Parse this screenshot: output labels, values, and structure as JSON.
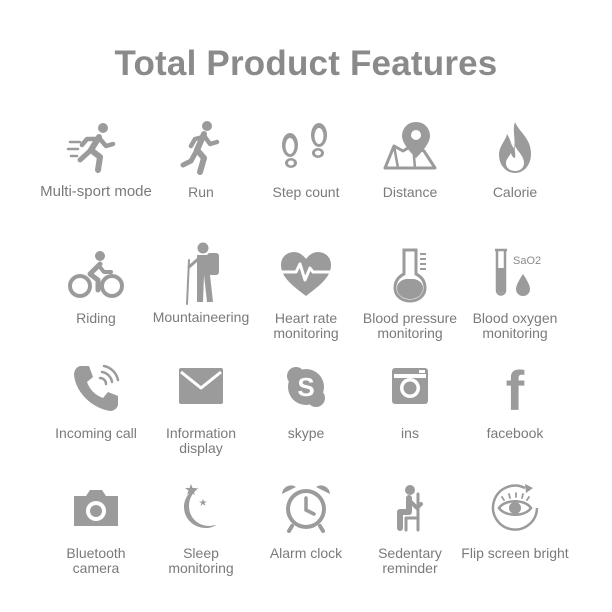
{
  "title": "Total Product Features",
  "features": [
    {
      "label": "Multi-sport mode",
      "icon": "running-person-speed-icon"
    },
    {
      "label": "Run",
      "icon": "runner-icon"
    },
    {
      "label": "Step count",
      "icon": "footprints-icon"
    },
    {
      "label": "Distance",
      "icon": "map-pin-icon"
    },
    {
      "label": "Calorie",
      "icon": "flame-icon"
    },
    {
      "label": "Riding",
      "icon": "cyclist-icon"
    },
    {
      "label": "Mountaineering",
      "icon": "hiker-icon"
    },
    {
      "label": "Heart rate\nmonitoring",
      "icon": "heart-pulse-icon"
    },
    {
      "label": "Blood pressure\nmonitoring",
      "icon": "thermometer-icon"
    },
    {
      "label": "Blood oxygen\nmonitoring",
      "icon": "test-tube-drop-icon",
      "icon_text": "SaO2"
    },
    {
      "label": "Incoming call",
      "icon": "phone-ringing-icon"
    },
    {
      "label": "Information\ndisplay",
      "icon": "envelope-icon"
    },
    {
      "label": "skype",
      "icon": "skype-icon",
      "icon_text": "S"
    },
    {
      "label": "ins",
      "icon": "instagram-icon"
    },
    {
      "label": "facebook",
      "icon": "facebook-icon",
      "icon_text": "f"
    },
    {
      "label": "Bluetooth\ncamera",
      "icon": "camera-icon"
    },
    {
      "label": "Sleep\nmonitoring",
      "icon": "moon-stars-icon"
    },
    {
      "label": "Alarm clock",
      "icon": "alarm-clock-icon"
    },
    {
      "label": "Sedentary\nreminder",
      "icon": "seated-person-icon"
    },
    {
      "label": "Flip screen bright",
      "icon": "eye-rotate-icon"
    }
  ],
  "colors": {
    "icon": "#9b9b9b",
    "text": "#7a7a7a",
    "title": "#8a8a8a",
    "background": "#ffffff"
  }
}
